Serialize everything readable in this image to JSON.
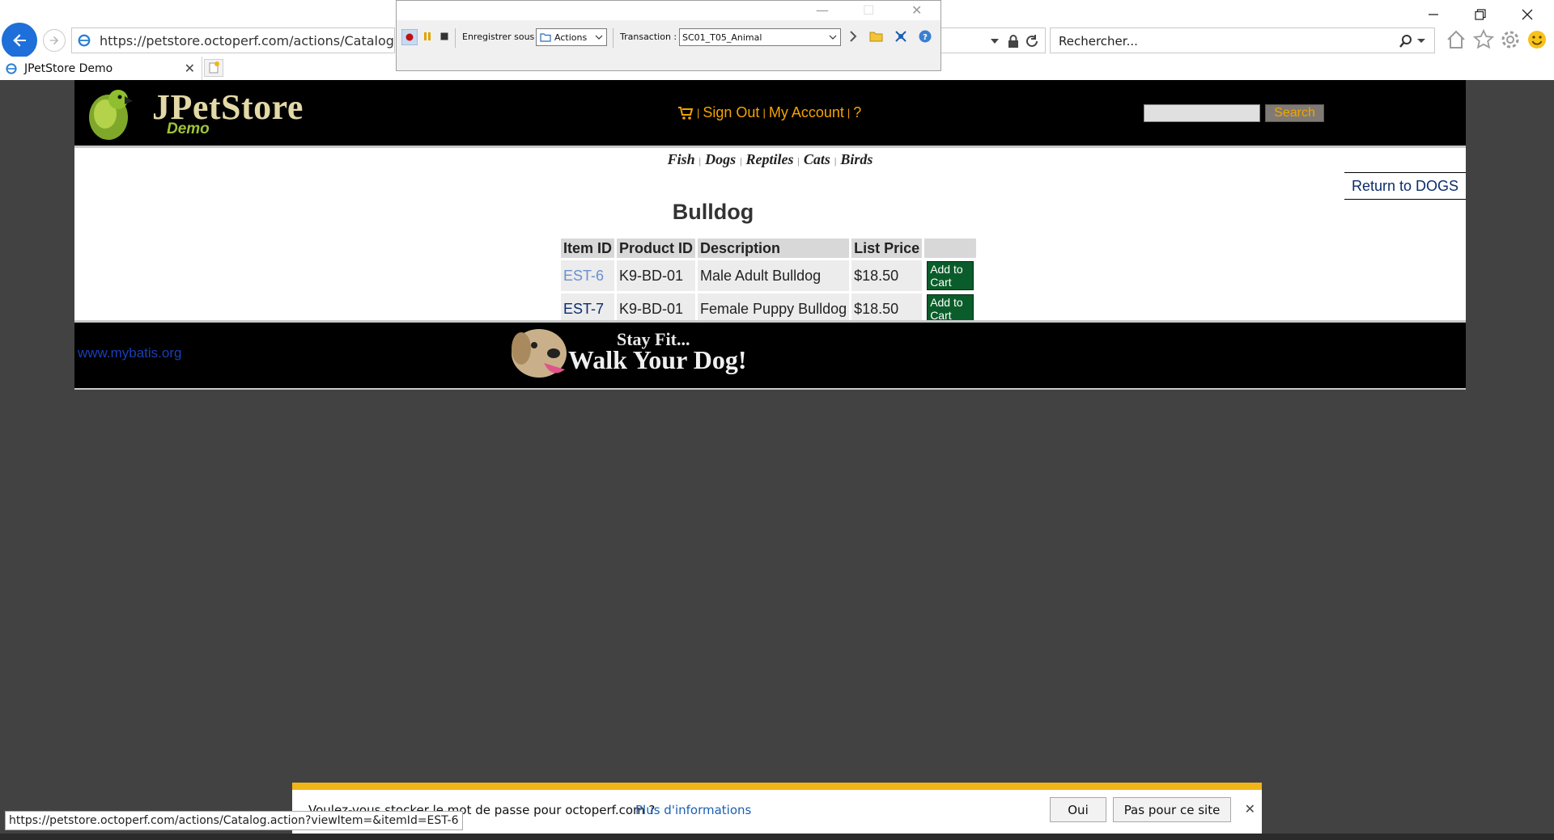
{
  "browser": {
    "address_url": "https://petstore.octoperf.com/actions/Catalog.action?vi",
    "search_placeholder": "Rechercher...",
    "tab_title": "JPetStore Demo"
  },
  "recorder": {
    "save_as_label": "Enregistrer sous :",
    "save_as_value": "Actions",
    "transaction_label": "Transaction :",
    "transaction_value": "SC01_T05_Animal"
  },
  "header": {
    "logo_title": "JPetStore",
    "logo_subtitle": "Demo",
    "sign_out": "Sign Out",
    "my_account": "My Account",
    "help": "?",
    "search_button": "Search"
  },
  "quicklinks": [
    "Fish",
    "Dogs",
    "Reptiles",
    "Cats",
    "Birds"
  ],
  "return_link": "Return to DOGS",
  "product_title": "Bulldog",
  "table": {
    "headers": [
      "Item ID",
      "Product ID",
      "Description",
      "List Price"
    ],
    "rows": [
      {
        "item_id": "EST-6",
        "product_id": "K9-BD-01",
        "description": "Male Adult Bulldog",
        "price": "$18.50",
        "action": "Add to Cart"
      },
      {
        "item_id": "EST-7",
        "product_id": "K9-BD-01",
        "description": "Female Puppy Bulldog",
        "price": "$18.50",
        "action": "Add to Cart"
      }
    ]
  },
  "footer": {
    "link": "www.mybatis.org",
    "banner_line1": "Stay Fit...",
    "banner_line2": "Walk Your Dog!"
  },
  "status_url": "https://petstore.octoperf.com/actions/Catalog.action?viewItem=&itemId=EST-6",
  "password_bar": {
    "message": "Voulez-vous stocker le mot de passe pour octoperf.com ?",
    "more_info": "Plus d'informations",
    "yes": "Oui",
    "not_for_site": "Pas pour ce site"
  },
  "colors": {
    "accent_orange": "#f5a300",
    "link_blue": "#0b2d6b",
    "add_button_green": "#0a5d2a",
    "password_bar_yellow": "#f1b518"
  }
}
